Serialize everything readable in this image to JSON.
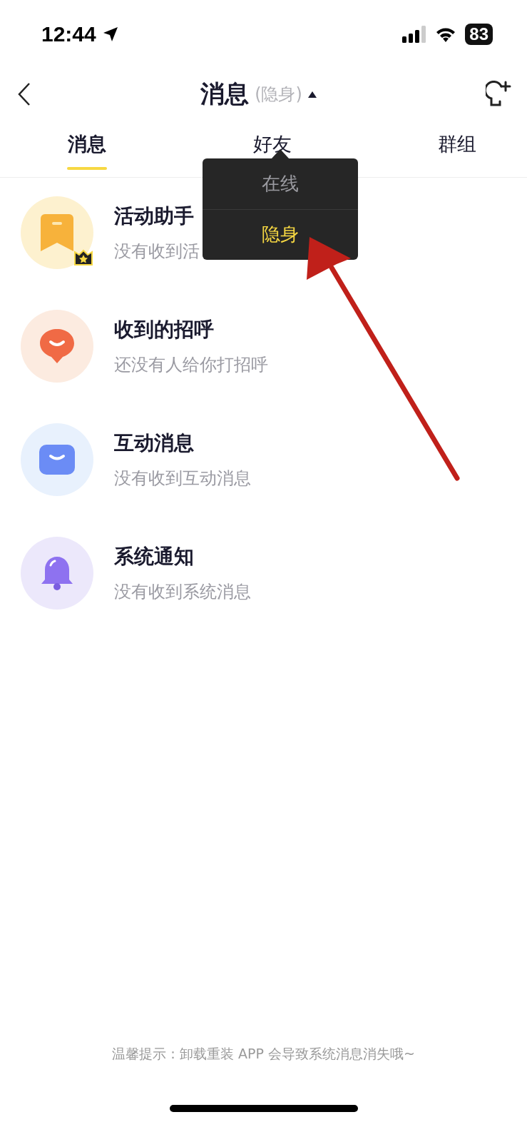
{
  "status_bar": {
    "time": "12:44",
    "battery": "83"
  },
  "nav": {
    "title": "消息",
    "status": "(隐身)"
  },
  "tabs": [
    {
      "label": "消息",
      "selected": true
    },
    {
      "label": "好友",
      "selected": false
    },
    {
      "label": "群组",
      "selected": false
    }
  ],
  "status_menu": {
    "items": [
      {
        "label": "在线",
        "selected": false
      },
      {
        "label": "隐身",
        "selected": true
      }
    ]
  },
  "messages": [
    {
      "kind": "activity",
      "title": "活动助手",
      "subtitle": "没有收到活"
    },
    {
      "kind": "greeting",
      "title": "收到的招呼",
      "subtitle": "还没有人给你打招呼"
    },
    {
      "kind": "interaction",
      "title": "互动消息",
      "subtitle": "没有收到互动消息"
    },
    {
      "kind": "system",
      "title": "系统通知",
      "subtitle": "没有收到系统消息"
    }
  ],
  "footer_tip": "温馨提示：卸载重装 APP 会导致系统消息消失哦~"
}
